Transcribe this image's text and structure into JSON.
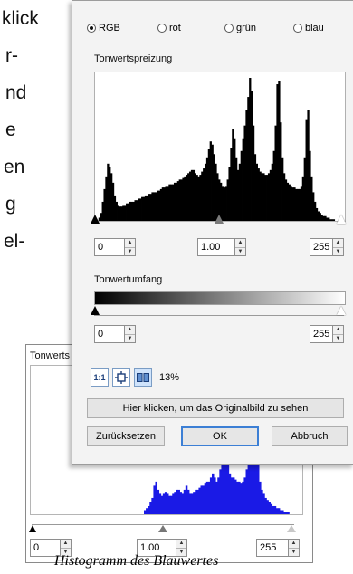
{
  "document": {
    "lines": [
      "klick",
      "r-",
      "nd",
      "e",
      "en",
      "g",
      "el-"
    ]
  },
  "main_dialog": {
    "channels": [
      {
        "label": "RGB",
        "selected": true
      },
      {
        "label": "rot",
        "selected": false
      },
      {
        "label": "grün",
        "selected": false
      },
      {
        "label": "blau",
        "selected": false
      }
    ],
    "tonwertspreizung": {
      "label": "Tonwertspreizung",
      "histogram_color": "#000000",
      "histogram": [
        0,
        0,
        2,
        5,
        12,
        20,
        28,
        36,
        34,
        30,
        24,
        16,
        12,
        10,
        9,
        9,
        10,
        10,
        11,
        11,
        12,
        12,
        12,
        13,
        13,
        14,
        14,
        15,
        15,
        16,
        16,
        17,
        17,
        18,
        18,
        18,
        19,
        19,
        20,
        21,
        21,
        22,
        22,
        23,
        23,
        23,
        24,
        24,
        25,
        26,
        26,
        27,
        28,
        29,
        30,
        31,
        32,
        32,
        30,
        29,
        28,
        29,
        31,
        33,
        36,
        40,
        45,
        50,
        48,
        42,
        36,
        30,
        26,
        24,
        22,
        21,
        22,
        26,
        34,
        46,
        58,
        52,
        40,
        32,
        36,
        44,
        52,
        60,
        70,
        78,
        90,
        82,
        60,
        42,
        36,
        33,
        31,
        30,
        30,
        29,
        29,
        30,
        32,
        36,
        44,
        60,
        86,
        88,
        62,
        40,
        30,
        26,
        24,
        23,
        22,
        21,
        21,
        20,
        20,
        20,
        22,
        28,
        40,
        64,
        70,
        44,
        28,
        18,
        12,
        8,
        6,
        5,
        4,
        3,
        3,
        2,
        2,
        1,
        1,
        1,
        0,
        0,
        0,
        0,
        0,
        0
      ],
      "min_value": "0",
      "mid_value": "1.00",
      "max_value": "255"
    },
    "tonwertumfang": {
      "label": "Tonwertumfang",
      "min_value": "0",
      "max_value": "255"
    },
    "view_buttons": {
      "one_to_one": "1:1",
      "zoom_percent": "13%"
    },
    "original_button": "Hier klicken, um das Originalbild zu sehen",
    "buttons": {
      "reset": "Zurücksetzen",
      "ok": "OK",
      "cancel": "Abbruch"
    }
  },
  "background_dialog": {
    "label": "Tonwerts",
    "histogram_color": "#1a1ae6",
    "histogram": [
      0,
      0,
      0,
      0,
      0,
      0,
      0,
      0,
      0,
      0,
      0,
      0,
      0,
      0,
      0,
      0,
      0,
      0,
      0,
      0,
      0,
      0,
      0,
      0,
      0,
      0,
      0,
      0,
      0,
      0,
      0,
      0,
      0,
      0,
      0,
      0,
      0,
      0,
      0,
      0,
      0,
      0,
      0,
      0,
      0,
      0,
      0,
      0,
      0,
      0,
      0,
      0,
      0,
      0,
      0,
      0,
      0,
      0,
      0,
      0,
      2,
      3,
      4,
      6,
      8,
      14,
      16,
      12,
      10,
      9,
      10,
      11,
      10,
      9,
      9,
      10,
      11,
      12,
      12,
      11,
      10,
      12,
      14,
      12,
      10,
      10,
      11,
      12,
      12,
      13,
      14,
      14,
      15,
      16,
      16,
      18,
      20,
      18,
      16,
      18,
      22,
      26,
      30,
      28,
      24,
      20,
      18,
      18,
      17,
      16,
      16,
      15,
      16,
      18,
      22,
      30,
      48,
      70,
      62,
      38,
      24,
      16,
      12,
      10,
      8,
      7,
      6,
      5,
      4,
      4,
      3,
      3,
      2,
      2,
      1,
      1,
      1,
      0,
      0,
      0,
      0,
      0,
      0,
      0
    ],
    "min_value": "0",
    "mid_value": "1.00",
    "max_value": "255"
  },
  "caption": "Histogramm des Blauwertes"
}
